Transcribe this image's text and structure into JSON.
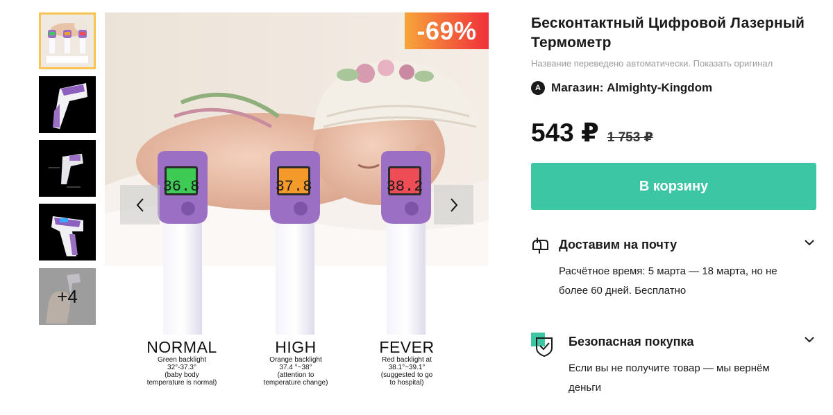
{
  "product": {
    "title": "Бесконтактный Цифровой Лазерный Термометр",
    "translation_note": "Название переведено автоматически. Показать оригинал",
    "shop_avatar_letter": "A",
    "shop_label": "Магазин: Almighty-Kingdom",
    "price_current": "543 ₽",
    "price_old": "1 753 ₽",
    "discount_badge": "-69%",
    "add_to_cart_label": "В корзину"
  },
  "gallery": {
    "more_label": "+4",
    "captions": [
      {
        "title": "NORMAL",
        "text": "Green backlight\n32°-37.3°\n(baby body\ntemperature is normal)",
        "reading": "36.8"
      },
      {
        "title": "HIGH",
        "text": "Orange backlight\n37.4 °~38°\n(attention to\ntemperature change)",
        "reading": "37.8"
      },
      {
        "title": "FEVER",
        "text": "Red backlight at\n38.1°~39.1°\n(suggested to go\nto hospital)",
        "reading": "38.2"
      }
    ]
  },
  "delivery": {
    "title": "Доставим на почту",
    "text": "Расчётное время: 5 марта — 18 марта, но не более 60 дней. Бесплатно"
  },
  "protection": {
    "title": "Безопасная покупка",
    "text": "Если вы не получите товар — мы вернём деньги"
  },
  "colors": {
    "accent_green": "#3cc6a4",
    "discount_from": "#f6a53a",
    "discount_to": "#f0303a",
    "thumb_active_border": "#f9c452",
    "thermometer_purple": "#9a6fc4"
  }
}
